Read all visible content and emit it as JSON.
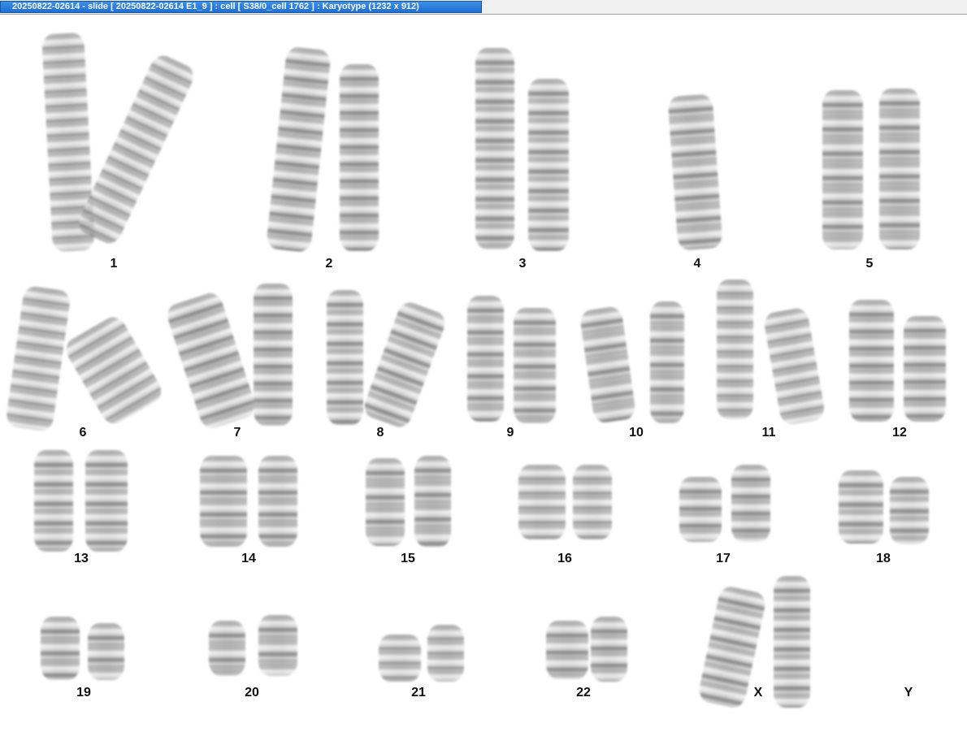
{
  "window": {
    "title": "20250822-02614 - slide [ 20250822-02614 E1_9 ] : cell [ S38/0_cell 1762 ] : Karyotype  (1232 x 912)"
  },
  "karyotype": {
    "labels": [
      "1",
      "2",
      "3",
      "4",
      "5",
      "6",
      "7",
      "8",
      "9",
      "10",
      "11",
      "12",
      "13",
      "14",
      "15",
      "16",
      "17",
      "18",
      "19",
      "20",
      "21",
      "22",
      "X",
      "Y"
    ]
  },
  "colors": {
    "title_accent": "#1f6fd1",
    "background": "#ffffff"
  }
}
